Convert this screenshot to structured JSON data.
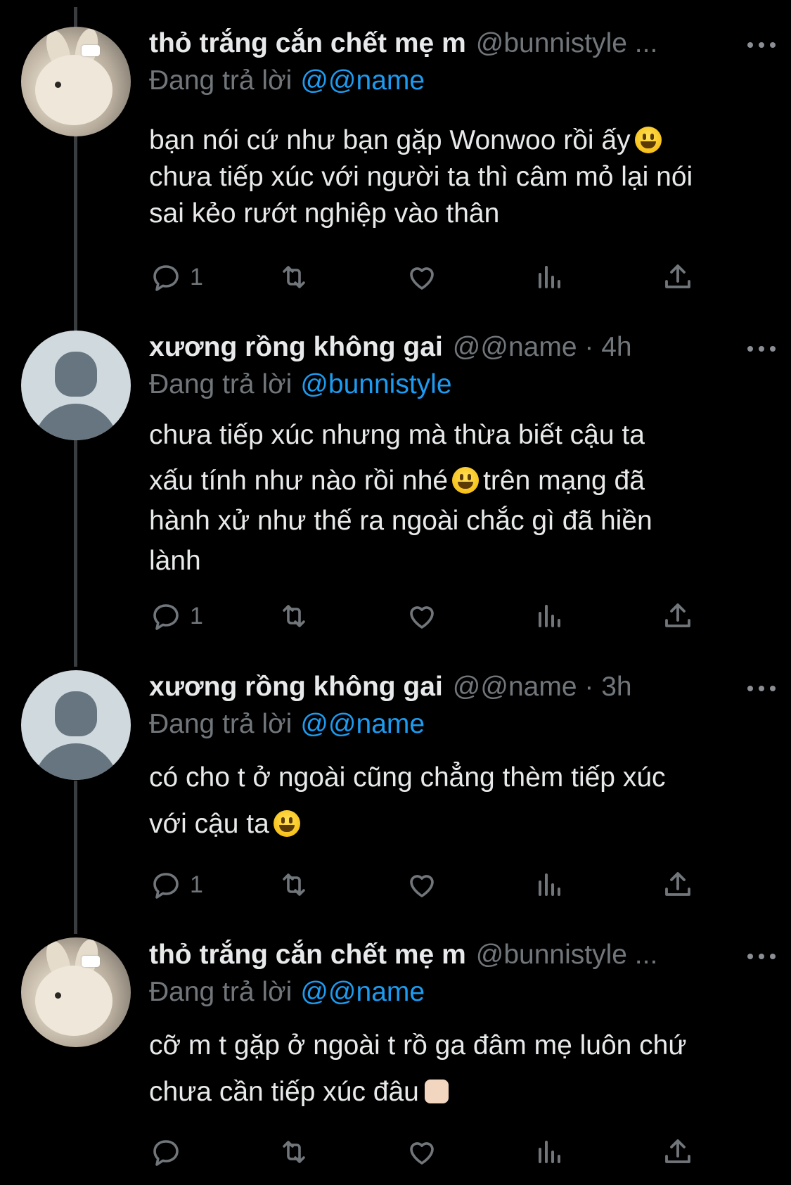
{
  "tweets": [
    {
      "avatar": "bunny",
      "display_name": "thỏ trắng cắn chết mẹ m",
      "handle": "@bunnistyle ...",
      "reply_prefix": "Đang trả lời",
      "reply_to": "@@name",
      "text_lines": [
        "bạn nói cứ như bạn gặp Wonwoo rồi ấy",
        "chưa tiếp xúc với người ta thì câm mỏ lại nói",
        "sai kẻo rướt nghiệp vào thân"
      ],
      "reply_count": "1"
    },
    {
      "avatar": "default",
      "display_name": "xương rồng không gai",
      "handle": "@@name · 4h",
      "reply_prefix": "Đang trả lời",
      "reply_to": "@bunnistyle",
      "text_lines": [
        "chưa tiếp xúc nhưng mà thừa biết cậu ta",
        "xấu tính như nào rồi nhé",
        "trên mạng đã",
        "hành xử như thế ra ngoài chắc gì đã hiền",
        "lành"
      ],
      "reply_count": "1"
    },
    {
      "avatar": "default",
      "display_name": "xương rồng không gai",
      "handle": "@@name · 3h",
      "reply_prefix": "Đang trả lời",
      "reply_to": "@@name",
      "text_lines": [
        "có cho t ở ngoài cũng chẳng thèm tiếp xúc",
        "với cậu ta"
      ],
      "reply_count": "1"
    },
    {
      "avatar": "bunny",
      "display_name": "thỏ trắng cắn chết mẹ m",
      "handle": "@bunnistyle ...",
      "reply_prefix": "Đang trả lời",
      "reply_to": "@@name",
      "text_lines": [
        "cỡ m t gặp ở ngoài t rồ ga đâm mẹ luôn chứ",
        "chưa cần tiếp xúc đâu"
      ],
      "reply_count": ""
    }
  ],
  "icons": {
    "reply": "reply-icon",
    "retweet": "retweet-icon",
    "like": "heart-icon",
    "views": "views-icon",
    "share": "share-icon",
    "more": "more-icon"
  },
  "colors": {
    "background": "#000000",
    "text": "#e7e9ea",
    "muted": "#71767b",
    "mention": "#1d9bf0",
    "thread_line": "#3a3d40"
  }
}
